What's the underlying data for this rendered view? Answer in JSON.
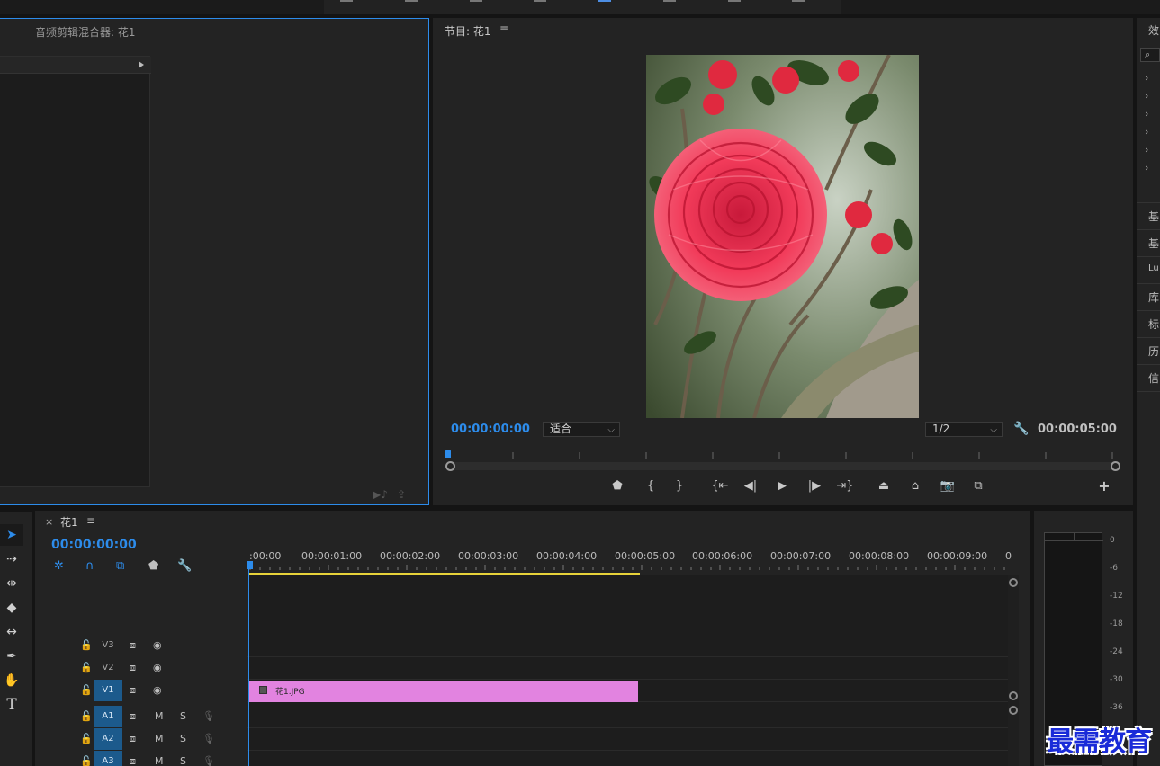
{
  "audio_panel": {
    "title": "音频剪辑混合器: 花1"
  },
  "program_monitor": {
    "title": "节目: 花1",
    "menu_icon": "≡",
    "timecode_current": "00:00:00:00",
    "zoom_dropdown": "适合",
    "resolution_dropdown": "1/2",
    "timecode_duration": "00:00:05:00"
  },
  "effects_panel": {
    "header": "效",
    "items": [
      "基",
      "基",
      "Lu",
      "库",
      "标",
      "历",
      "信"
    ]
  },
  "timeline": {
    "close_label": "×",
    "sequence_name": "花1",
    "menu_icon": "≡",
    "timecode": "00:00:00:00",
    "ruler_labels": [
      ":00:00",
      "00:00:01:00",
      "00:00:02:00",
      "00:00:03:00",
      "00:00:04:00",
      "00:00:05:00",
      "00:00:06:00",
      "00:00:07:00",
      "00:00:08:00",
      "00:00:09:00",
      "0"
    ],
    "tracks": [
      {
        "name": "V3",
        "type": "video",
        "selected": false
      },
      {
        "name": "V2",
        "type": "video",
        "selected": false
      },
      {
        "name": "V1",
        "type": "video",
        "selected": true
      },
      {
        "name": "A1",
        "type": "audio",
        "selected": true
      },
      {
        "name": "A2",
        "type": "audio",
        "selected": true
      },
      {
        "name": "A3",
        "type": "audio",
        "selected": true
      }
    ],
    "mute_label": "M",
    "solo_label": "S",
    "clip": {
      "label": "花1.JPG",
      "color": "#e283e0"
    }
  },
  "audio_meters": {
    "scale": [
      "0",
      "-6",
      "-12",
      "-18",
      "-24",
      "-30",
      "-36"
    ]
  },
  "watermark": "最需教育",
  "colors": {
    "accent": "#2d8ceb",
    "work_area": "#e6d23a",
    "clip": "#e283e0"
  }
}
